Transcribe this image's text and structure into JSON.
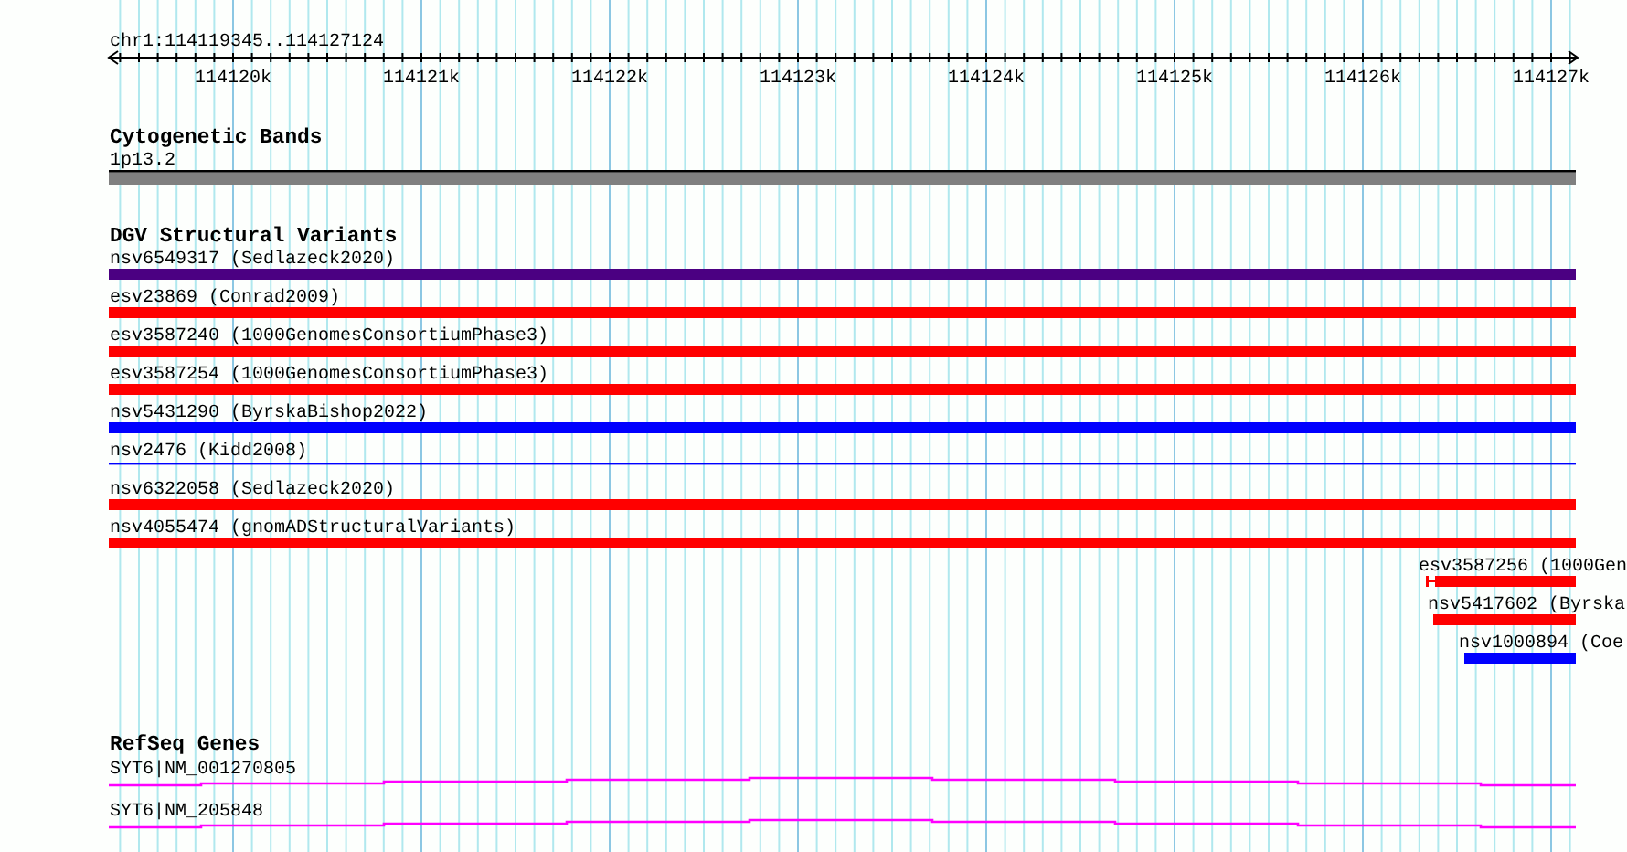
{
  "location": "chr1:114119345..114127124",
  "ruler": {
    "ticks": [
      "114120k",
      "114121k",
      "114122k",
      "114123k",
      "114124k",
      "114125k",
      "114126k",
      "114127k"
    ]
  },
  "tracks": [
    {
      "title": "Cytogenetic Bands",
      "features": [
        {
          "label": "1p13.2",
          "kind": "band",
          "color": "#808080"
        }
      ]
    },
    {
      "title": "DGV Structural Variants",
      "features": [
        {
          "label": "nsv6549317 (Sedlazeck2020)",
          "kind": "bar",
          "color": "#4b0082"
        },
        {
          "label": "esv23869 (Conrad2009)",
          "kind": "bar",
          "color": "#ff0000"
        },
        {
          "label": "esv3587240 (1000GenomesConsortiumPhase3)",
          "kind": "bar",
          "color": "#ff0000"
        },
        {
          "label": "esv3587254 (1000GenomesConsortiumPhase3)",
          "kind": "bar",
          "color": "#ff0000"
        },
        {
          "label": "nsv5431290 (ByrskaBishop2022)",
          "kind": "bar",
          "color": "#0000ff"
        },
        {
          "label": "nsv2476 (Kidd2008)",
          "kind": "line",
          "color": "#0000ff"
        },
        {
          "label": "nsv6322058 (Sedlazeck2020)",
          "kind": "bar",
          "color": "#ff0000"
        },
        {
          "label": "nsv4055474 (gnomADStructuralVariants)",
          "kind": "bar",
          "color": "#ff0000"
        },
        {
          "label": "esv3587256 (1000Gen",
          "kind": "bar",
          "color": "#ff0000"
        },
        {
          "label": "nsv5417602 (Byrska",
          "kind": "bar",
          "color": "#ff0000"
        },
        {
          "label": "nsv1000894 (Coe",
          "kind": "bar",
          "color": "#0000ff"
        }
      ]
    },
    {
      "title": "RefSeq Genes",
      "features": [
        {
          "label": "SYT6|NM_001270805",
          "kind": "gene",
          "color": "#ff00ff"
        },
        {
          "label": "SYT6|NM_205848",
          "kind": "gene",
          "color": "#ff00ff"
        }
      ]
    }
  ]
}
